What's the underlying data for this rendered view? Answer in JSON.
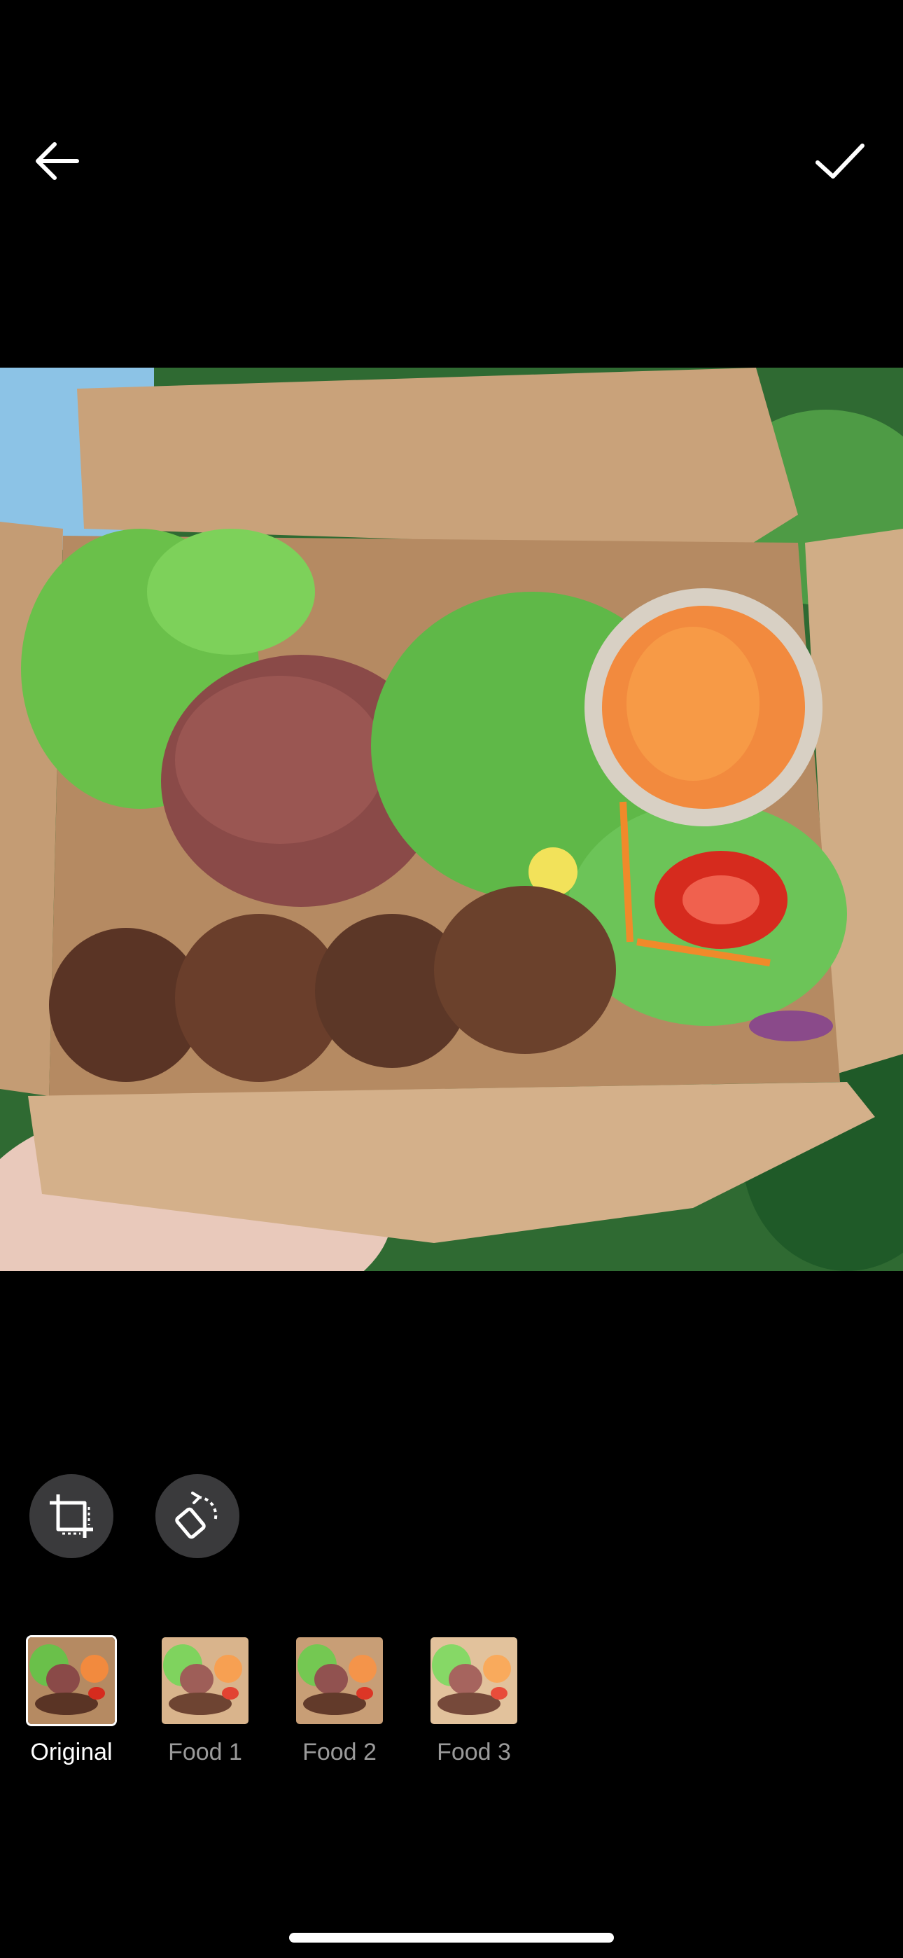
{
  "header": {
    "back_icon": "arrow-left-icon",
    "confirm_icon": "checkmark-icon"
  },
  "photo": {
    "description_icon": "food-photo"
  },
  "tools": {
    "crop_icon": "crop-icon",
    "rotate_icon": "rotate-icon"
  },
  "filters": [
    {
      "label": "Original",
      "selected": true
    },
    {
      "label": "Food 1",
      "selected": false
    },
    {
      "label": "Food 2",
      "selected": false
    },
    {
      "label": "Food 3",
      "selected": false
    }
  ],
  "colors": {
    "background": "#000000",
    "tool_button": "#3a3a3c",
    "label_inactive": "#9a9a9a",
    "label_active": "#ffffff"
  }
}
